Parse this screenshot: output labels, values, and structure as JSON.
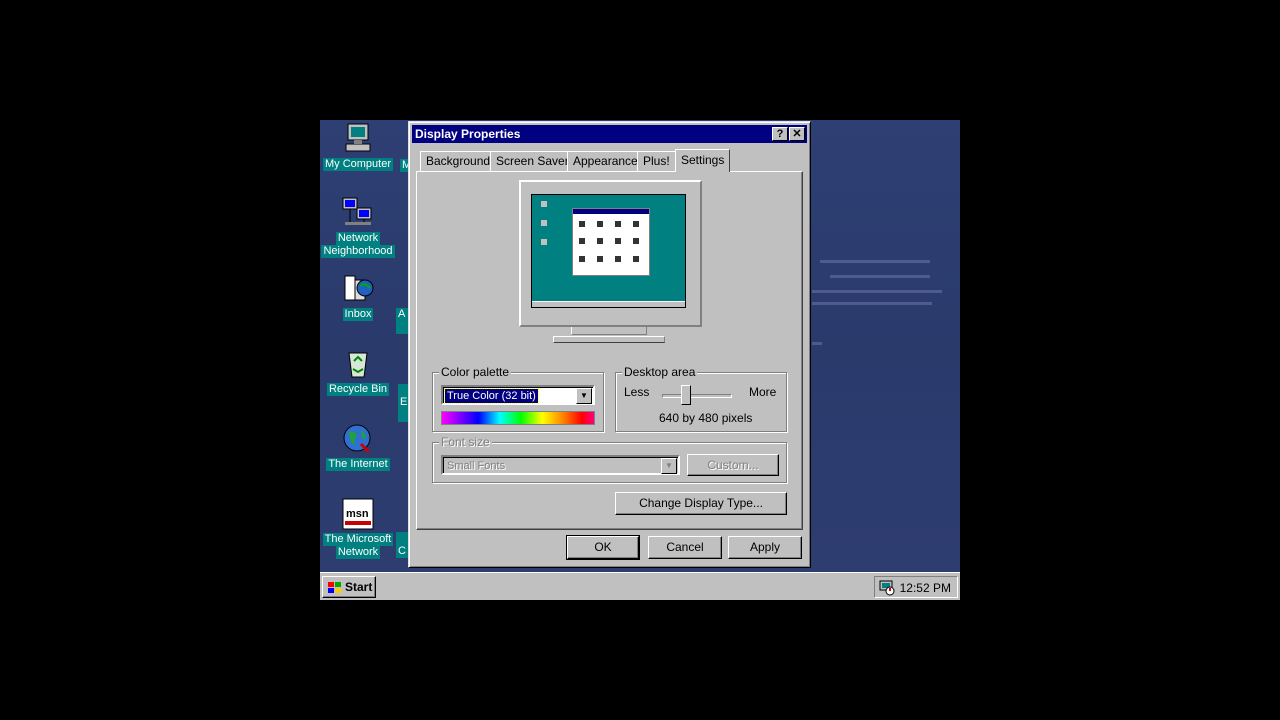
{
  "desktop": {
    "icons": [
      {
        "label_lines": [
          "My Computer"
        ]
      },
      {
        "label_lines": [
          "Network",
          "Neighborhood"
        ]
      },
      {
        "label_lines": [
          "Inbox"
        ]
      },
      {
        "label_lines": [
          "Recycle Bin"
        ]
      },
      {
        "label_lines": [
          "The Internet"
        ]
      },
      {
        "label_lines": [
          "The Microsoft",
          "Network"
        ]
      }
    ],
    "clipped_labels": [
      "M",
      "A",
      "E",
      "C"
    ]
  },
  "window": {
    "title": "Display Properties",
    "help_glyph": "?",
    "close_glyph": "✕",
    "tabs": [
      "Background",
      "Screen Saver",
      "Appearance",
      "Plus!",
      "Settings"
    ],
    "active_tab": "Settings",
    "color_palette": {
      "legend": "Color palette",
      "value": "True Color (32 bit)",
      "arrow": "▼"
    },
    "desktop_area": {
      "legend": "Desktop area",
      "less": "Less",
      "more": "More",
      "resolution": "640 by 480 pixels",
      "slider_fraction": 0.3
    },
    "font_size": {
      "legend": "Font size",
      "value": "Small Fonts",
      "custom_button": "Custom...",
      "enabled": false
    },
    "change_display_type": "Change Display Type...",
    "buttons": {
      "ok": "OK",
      "cancel": "Cancel",
      "apply": "Apply"
    }
  },
  "taskbar": {
    "start_label": "Start",
    "clock": "12:52 PM"
  }
}
